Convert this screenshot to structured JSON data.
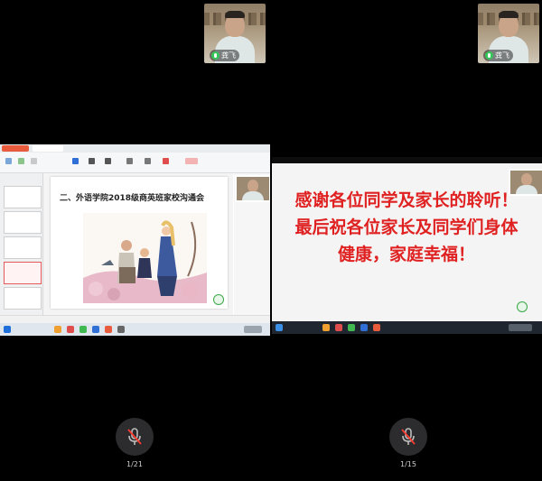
{
  "participants": {
    "left": {
      "name": "龚飞"
    },
    "right": {
      "name": "龚飞"
    }
  },
  "left_share": {
    "slide_title": "二、外语学院2018级商英班家校沟通会"
  },
  "right_share": {
    "message_line1": "感谢各位同学及家长的聆听！",
    "message_line2": "最后祝各位家长及同学们身体",
    "message_line3": "健康，家庭幸福！"
  },
  "bottom_controls": {
    "left_pager": "1/21",
    "right_pager": "1/15"
  },
  "icons": {
    "mic": "microphone-muted-icon"
  },
  "colors": {
    "background": "#000000",
    "message_red": "#e02121",
    "mic_green": "#34c759"
  }
}
